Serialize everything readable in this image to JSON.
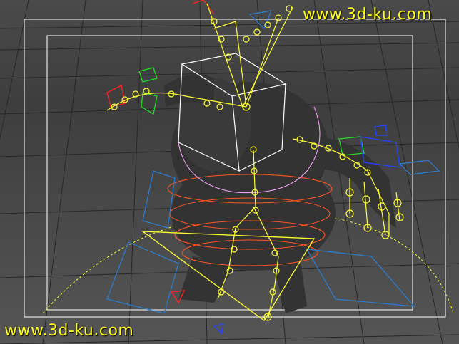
{
  "viewport": {
    "watermark_top": "www.3d-ku.com",
    "watermark_bottom": "www.3d-ku.com"
  },
  "colors": {
    "background": "#4a4a4a",
    "grid": "#2a2a2a",
    "frame": "#ffffff",
    "bones": "#ffff33",
    "ik_green": "#22dd22",
    "ik_blue": "#2244ff",
    "control_red": "#ff2222",
    "cyan_controls": "#2a7fd4",
    "orange_rings": "#ff5522",
    "pink_curve": "#ffaaff",
    "character": "#333333",
    "watermark": "#ffff1a"
  },
  "icons": {
    "skeleton": "bone-chain-icon",
    "head_control": "head-control-box-icon",
    "hand_control": "hand-ik-box-icon",
    "root_control": "root-triangle-icon"
  }
}
